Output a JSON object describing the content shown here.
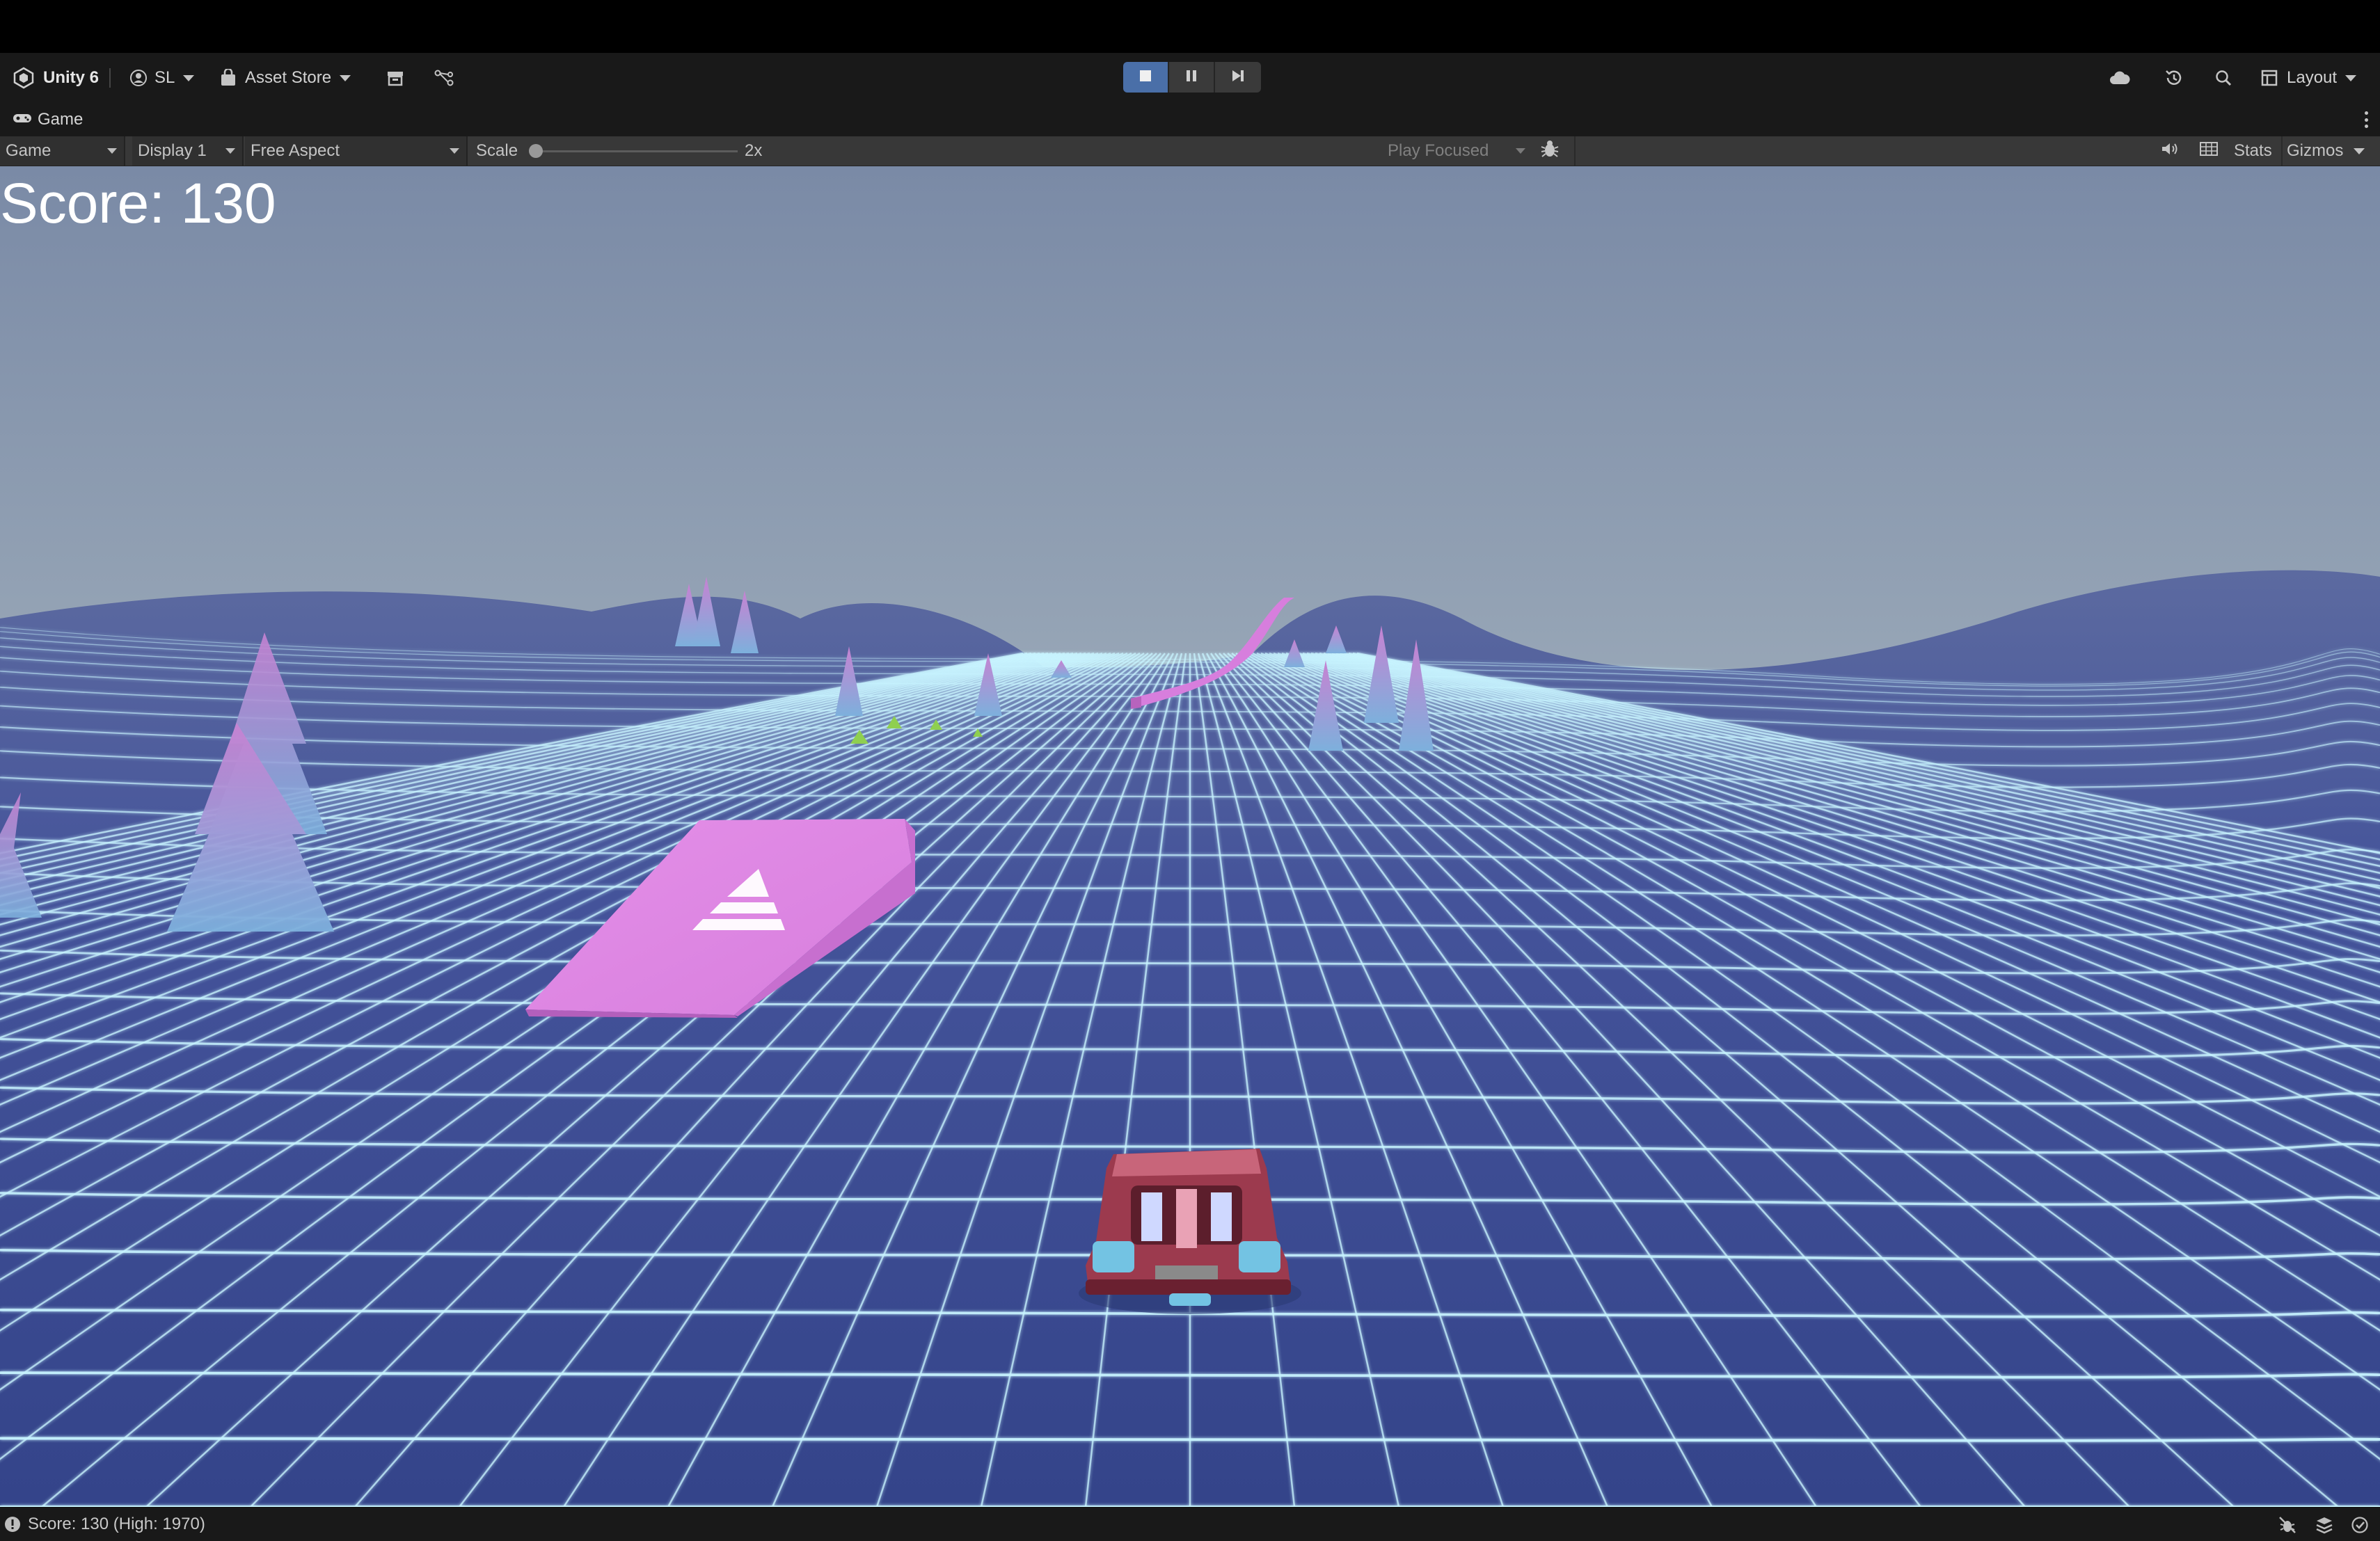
{
  "toolbar": {
    "unity_version": "Unity 6",
    "account": "SL",
    "asset_store": "Asset Store",
    "layout": "Layout",
    "play_state": "playing"
  },
  "game_tab": {
    "title": "Game"
  },
  "game_bar": {
    "view_dropdown": "Game",
    "display_dropdown": "Display 1",
    "aspect_dropdown": "Free Aspect",
    "scale_label": "Scale",
    "scale_value": "2x",
    "play_mode_dropdown": "Play Focused",
    "stats_label": "Stats",
    "gizmos_label": "Gizmos"
  },
  "game": {
    "score_text": "Score: 130"
  },
  "status_bar": {
    "message": "Score: 130 (High: 1970)"
  },
  "colors": {
    "sky_top": "#7c8ca8",
    "sky_horizon": "#c9d3d0",
    "terrain": "#3a4a85",
    "grid_line": "#c8f4ff",
    "ramp_pink": "#e08ae6",
    "trees": "#c98ad4",
    "car_body": "#9c3a4e",
    "play_active": "#4a6fa8"
  },
  "icons": [
    "unity-logo-icon",
    "account-icon",
    "asset-store-icon",
    "package-icon",
    "version-control-icon",
    "stop-icon",
    "pause-icon",
    "step-icon",
    "cloud-icon",
    "history-icon",
    "search-icon",
    "layout-icon",
    "gamepad-icon",
    "kebab-menu-icon",
    "bug-icon",
    "audio-icon",
    "grid-icon",
    "info-icon",
    "debug-icon",
    "stack-icon",
    "check-icon"
  ]
}
